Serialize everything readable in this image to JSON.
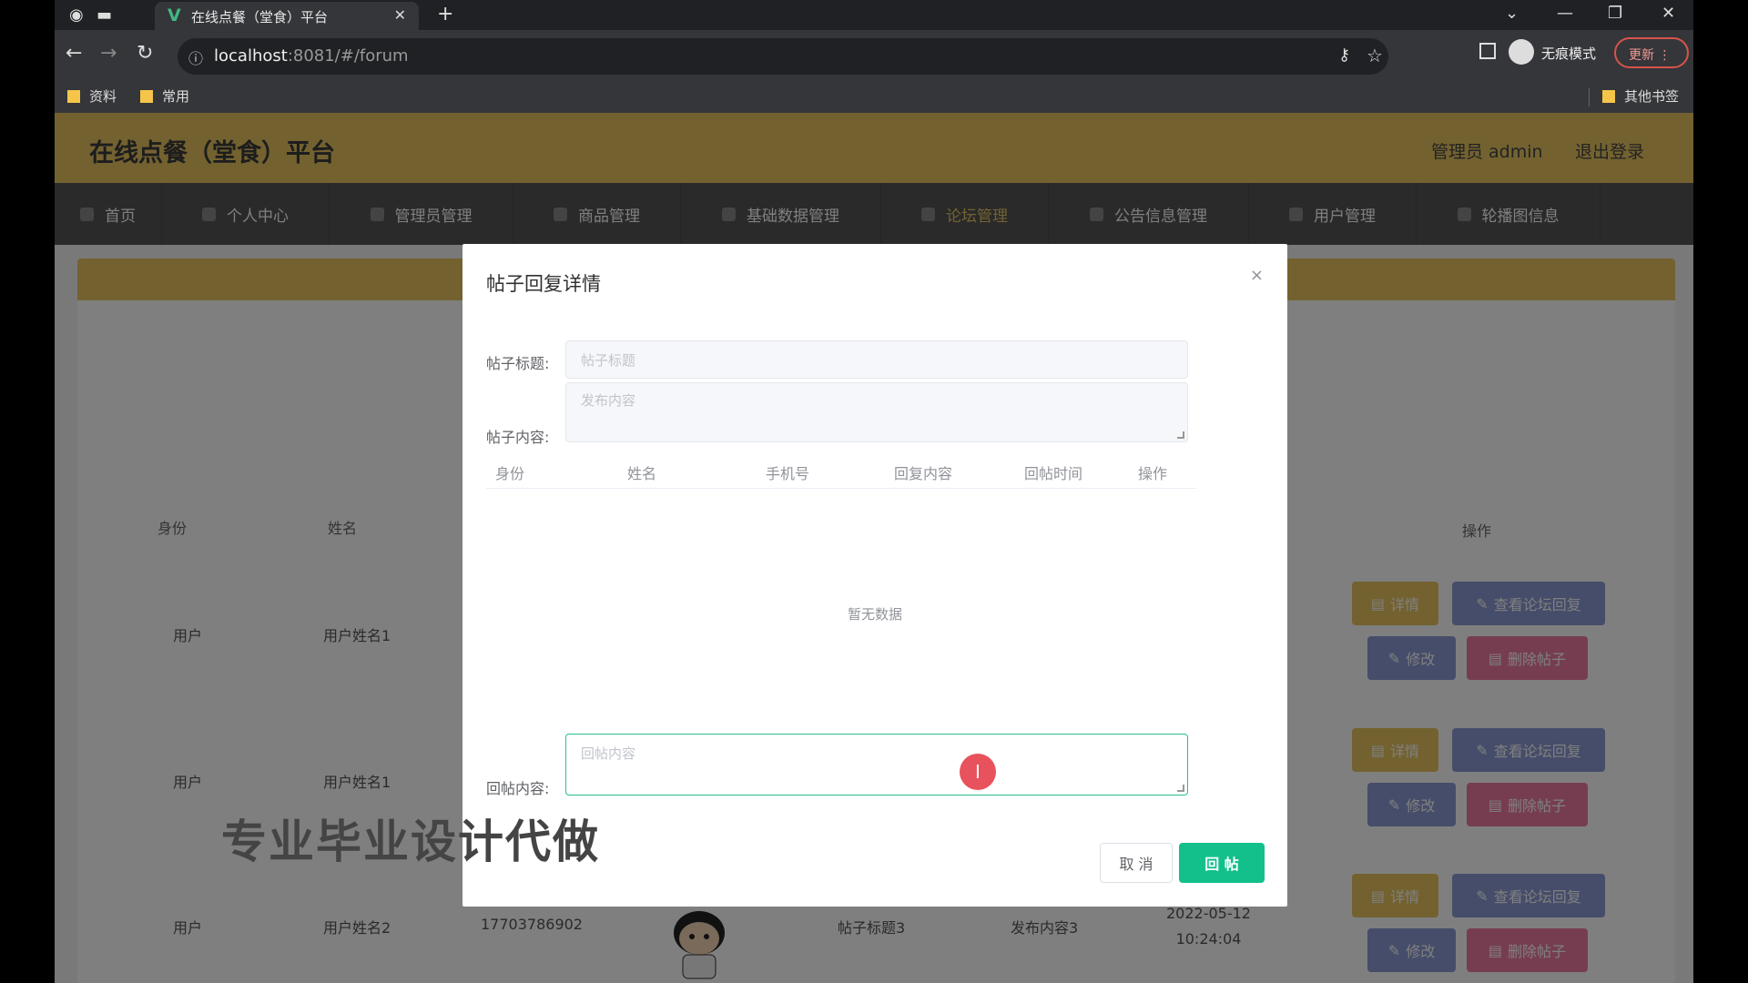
{
  "browser": {
    "tab_title": "在线点餐（堂食）平台",
    "tab_icon": "V",
    "new_tab": "+",
    "url_host": "localhost",
    "url_rest": ":8081/#/forum",
    "incognito_label": "无痕模式",
    "update_label": "更新",
    "bookmarks": [
      "资料",
      "常用"
    ],
    "other_bookmarks": "其他书签"
  },
  "header": {
    "title": "在线点餐（堂食）平台",
    "user": "管理员 admin",
    "logout": "退出登录"
  },
  "menu": [
    {
      "label": "首页",
      "icon": "home-icon"
    },
    {
      "label": "个人中心",
      "icon": "user-icon"
    },
    {
      "label": "管理员管理",
      "icon": "admin-icon"
    },
    {
      "label": "商品管理",
      "icon": "goods-icon"
    },
    {
      "label": "基础数据管理",
      "icon": "data-icon"
    },
    {
      "label": "论坛管理",
      "icon": "forum-icon",
      "active": true
    },
    {
      "label": "公告信息管理",
      "icon": "notice-icon"
    },
    {
      "label": "用户管理",
      "icon": "users-icon"
    },
    {
      "label": "轮播图信息",
      "icon": "carousel-icon"
    }
  ],
  "table": {
    "headers": [
      "身份",
      "姓名",
      "操作"
    ],
    "rows": [
      {
        "role": "用户",
        "name": "用户姓名1"
      },
      {
        "role": "用户",
        "name": "用户姓名1"
      },
      {
        "role": "用户",
        "name": "用户姓名2",
        "phone": "17703786902",
        "title": "帖子标题3",
        "content": "发布内容3",
        "time": "2022-05-12 10:24:04"
      }
    ],
    "actions": {
      "detail": "详情",
      "view_reply": "查看论坛回复",
      "edit": "修改",
      "delete": "删除帖子"
    }
  },
  "dialog": {
    "title": "帖子回复详情",
    "close": "×",
    "post_title_label": "帖子标题:",
    "post_title_placeholder": "帖子标题",
    "post_content_label": "帖子内容:",
    "post_content_placeholder": "发布内容",
    "columns": [
      "身份",
      "姓名",
      "手机号",
      "回复内容",
      "回帖时间",
      "操作"
    ],
    "empty_text": "暂无数据",
    "reply_label": "回帖内容:",
    "reply_placeholder": "回帖内容",
    "cancel": "取 消",
    "submit": "回 帖"
  },
  "watermark": "专业毕业设计代做"
}
